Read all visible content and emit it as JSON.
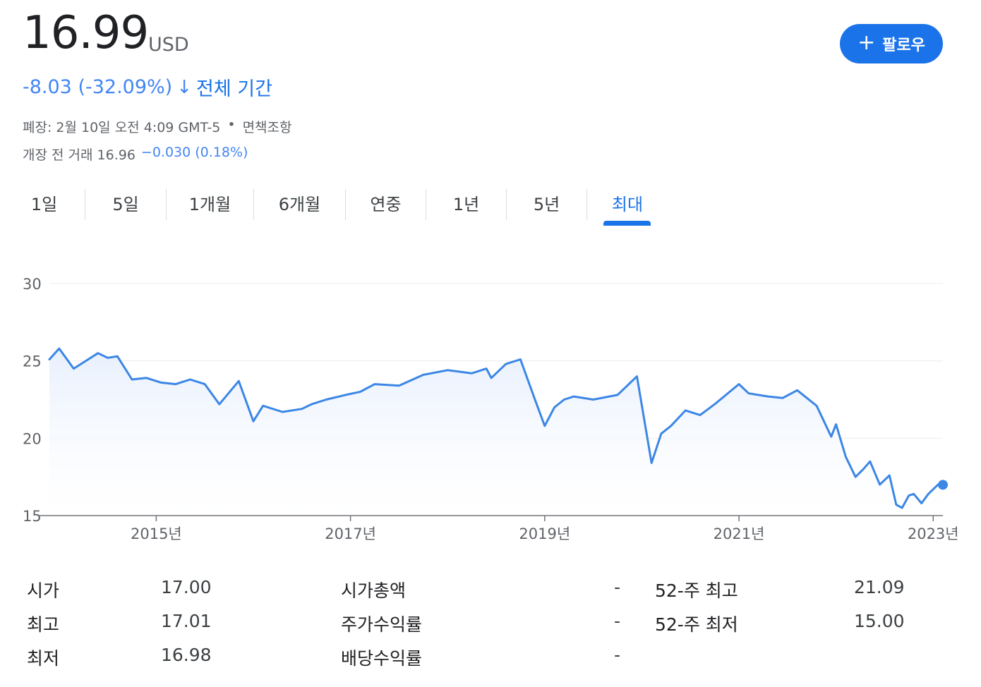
{
  "quote": {
    "price": "16.99",
    "currency": "USD",
    "change": "-8.03 (-32.09%)",
    "change_arrow": "↓",
    "period": "전체 기간",
    "closed_label": "폐장: 2월 10일 오전 4:09 GMT-5",
    "separator": "•",
    "disclaimer": "면책조항",
    "premarket_label": "개장 전 거래 16.96",
    "premarket_change": "−0.030 (0.18%)"
  },
  "follow_button": {
    "icon": "plus-icon",
    "label": "팔로우"
  },
  "colors": {
    "accent": "#1a73e8",
    "line": "#3b86e6",
    "fill": "#e8f0fd",
    "negative": "#4285f4"
  },
  "tabs": [
    {
      "label": "1일"
    },
    {
      "label": "5일"
    },
    {
      "label": "1개월"
    },
    {
      "label": "6개월"
    },
    {
      "label": "연중"
    },
    {
      "label": "1년"
    },
    {
      "label": "5년"
    },
    {
      "label": "최대",
      "active": true
    }
  ],
  "chart_data": {
    "type": "area",
    "title": "",
    "xlabel": "",
    "ylabel": "",
    "ylim": [
      15,
      30
    ],
    "yticks": [
      "30",
      "25",
      "20",
      "15"
    ],
    "xtick_labels": [
      {
        "label": "2015년",
        "year": 2015
      },
      {
        "label": "2017년",
        "year": 2017
      },
      {
        "label": "2019년",
        "year": 2019
      },
      {
        "label": "2021년",
        "year": 2021
      },
      {
        "label": "2023년",
        "year": 2023
      }
    ],
    "grid": true,
    "series": [
      {
        "x": [
          2013.9,
          2014.0,
          2014.15,
          2014.3,
          2014.4,
          2014.5,
          2014.6,
          2014.75,
          2014.9,
          2015.05,
          2015.2,
          2015.35,
          2015.5,
          2015.65,
          2015.85,
          2016.0,
          2016.1,
          2016.3,
          2016.5,
          2016.6,
          2016.75,
          2016.95,
          2017.1,
          2017.25,
          2017.5,
          2017.75,
          2018.0,
          2018.25,
          2018.4,
          2018.45,
          2018.6,
          2018.75,
          2018.9,
          2019.0,
          2019.1,
          2019.2,
          2019.3,
          2019.5,
          2019.75,
          2019.95,
          2020.1,
          2020.2,
          2020.3,
          2020.45,
          2020.6,
          2020.75,
          2021.0,
          2021.1,
          2021.3,
          2021.45,
          2021.6,
          2021.8,
          2021.95,
          2022.0,
          2022.1,
          2022.2,
          2022.28,
          2022.35,
          2022.45,
          2022.55,
          2022.62,
          2022.68,
          2022.75,
          2022.8,
          2022.88,
          2022.95,
          2023.05,
          2023.1
        ],
        "y": [
          25.1,
          25.8,
          24.5,
          25.1,
          25.5,
          25.2,
          25.3,
          23.8,
          23.9,
          23.6,
          23.5,
          23.8,
          23.5,
          22.2,
          23.7,
          21.1,
          22.1,
          21.7,
          21.9,
          22.2,
          22.5,
          22.8,
          23.0,
          23.5,
          23.4,
          24.1,
          24.4,
          24.2,
          24.5,
          23.9,
          24.8,
          25.1,
          22.5,
          20.8,
          22.0,
          22.5,
          22.7,
          22.5,
          22.8,
          24.0,
          18.4,
          20.3,
          20.8,
          21.8,
          21.5,
          22.2,
          23.5,
          22.9,
          22.7,
          22.6,
          23.1,
          22.1,
          20.1,
          20.9,
          18.8,
          17.5,
          18.0,
          18.5,
          17.0,
          17.6,
          15.7,
          15.5,
          16.3,
          16.4,
          15.8,
          16.4,
          17.0,
          16.99
        ]
      }
    ]
  },
  "stats": [
    [
      {
        "label": "시가",
        "value": "17.00"
      },
      {
        "label": "시가총액",
        "value": "-"
      },
      {
        "label": "52-주 최고",
        "value": "21.09"
      }
    ],
    [
      {
        "label": "최고",
        "value": "17.01"
      },
      {
        "label": "주가수익률",
        "value": "-"
      },
      {
        "label": "52-주 최저",
        "value": "15.00"
      }
    ],
    [
      {
        "label": "최저",
        "value": "16.98"
      },
      {
        "label": "배당수익률",
        "value": "-"
      }
    ]
  ]
}
